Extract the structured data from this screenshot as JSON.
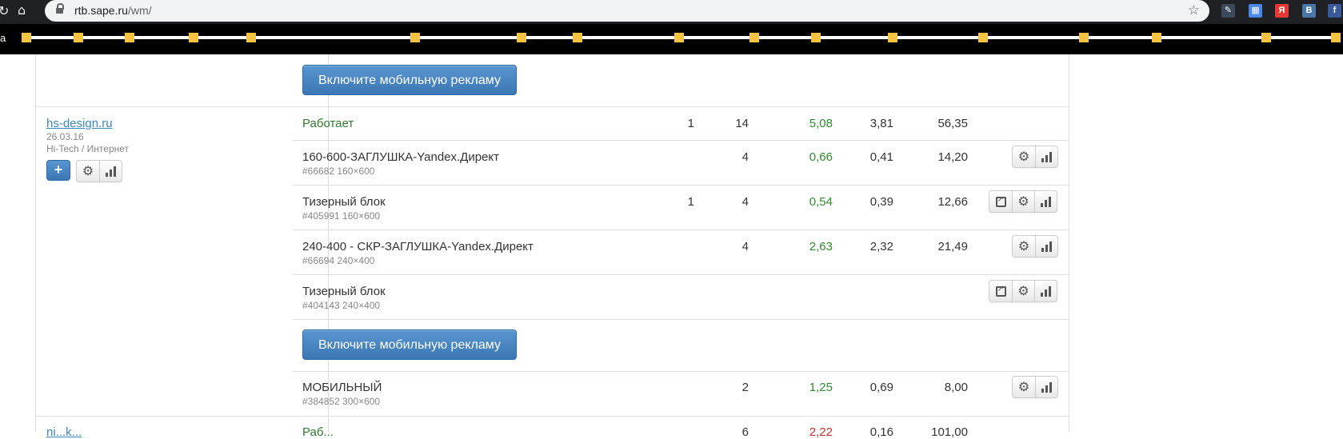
{
  "browser": {
    "url_host": "rtb.sape.ru",
    "url_path": "/wm/",
    "bookmarks_label": "a"
  },
  "buttons": {
    "mobile_ads": "Включите мобильную рекламу",
    "add": "+"
  },
  "site": {
    "name": "hs-design.ru",
    "date": "26.03.16",
    "category": "Hi-Tech / Интернет"
  },
  "summary": {
    "status": "Работает",
    "c1": "1",
    "c2": "14",
    "c3": "5,08",
    "c4": "3,81",
    "c5": "56,35"
  },
  "blocks": [
    {
      "name": "160-600-ЗАГЛУШКА-Yandex.Директ",
      "sub": "#66682 160×600",
      "c1": "",
      "c2": "4",
      "c3": "0,66",
      "c4": "0,41",
      "c5": "14,20"
    },
    {
      "name": "Тизерный блок",
      "sub": "#405991 160×600",
      "c1": "1",
      "c2": "4",
      "c3": "0,54",
      "c4": "0,39",
      "c5": "12,66"
    },
    {
      "name": "240-400 - СКР-ЗАГЛУШКА-Yandex.Директ",
      "sub": "#66694 240×400",
      "c1": "",
      "c2": "4",
      "c3": "2,63",
      "c4": "2,32",
      "c5": "21,49"
    },
    {
      "name": "Тизерный блок",
      "sub": "#404143 240×400",
      "c1": "",
      "c2": "",
      "c3": "",
      "c4": "",
      "c5": ""
    },
    {
      "name": "МОБИЛЬНЫЙ",
      "sub": "#384852 300×600",
      "c1": "",
      "c2": "2",
      "c3": "1,25",
      "c4": "0,69",
      "c5": "8,00"
    }
  ],
  "next_row": {
    "site_partial": "ni...k...",
    "status_partial": "Раб...",
    "c2": "6",
    "c3": "2,22",
    "c4": "0,16",
    "c5": "101,00"
  }
}
